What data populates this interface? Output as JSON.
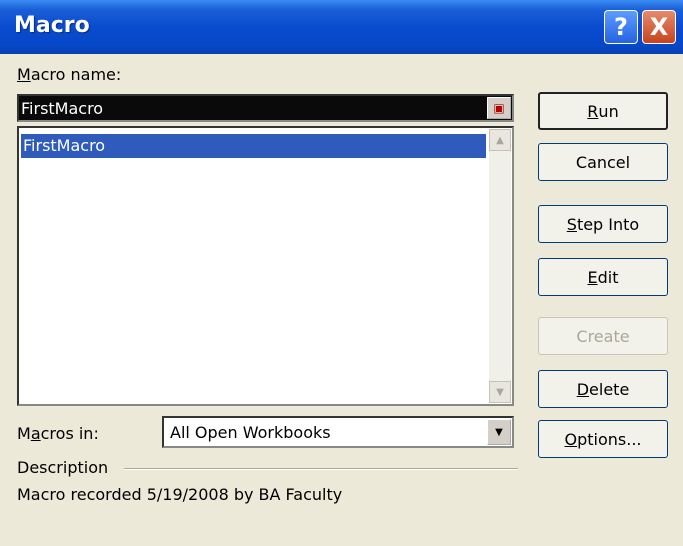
{
  "window": {
    "title": "Macro",
    "help_label": "?",
    "close_label": "X"
  },
  "macro_name": {
    "label": "Macro name:",
    "label_mnemonic": "M",
    "label_rest": "acro name:",
    "value": "FirstMacro"
  },
  "macro_list": {
    "items": [
      "FirstMacro"
    ],
    "selected_index": 0
  },
  "buttons": {
    "run": {
      "mnemonic": "R",
      "rest": "un"
    },
    "cancel": {
      "label": "Cancel"
    },
    "step_into": {
      "mnemonic": "S",
      "rest": "tep Into"
    },
    "edit": {
      "mnemonic": "E",
      "rest": "dit"
    },
    "create": {
      "label": "Create"
    },
    "delete": {
      "mnemonic": "D",
      "rest": "elete"
    },
    "options": {
      "mnemonic": "O",
      "rest": "ptions..."
    }
  },
  "macros_in": {
    "pre": "M",
    "mnemonic": "a",
    "rest": "cros in:",
    "selected": "All Open Workbooks"
  },
  "description": {
    "heading": "Description",
    "text": "Macro recorded 5/19/2008 by BA Faculty"
  }
}
